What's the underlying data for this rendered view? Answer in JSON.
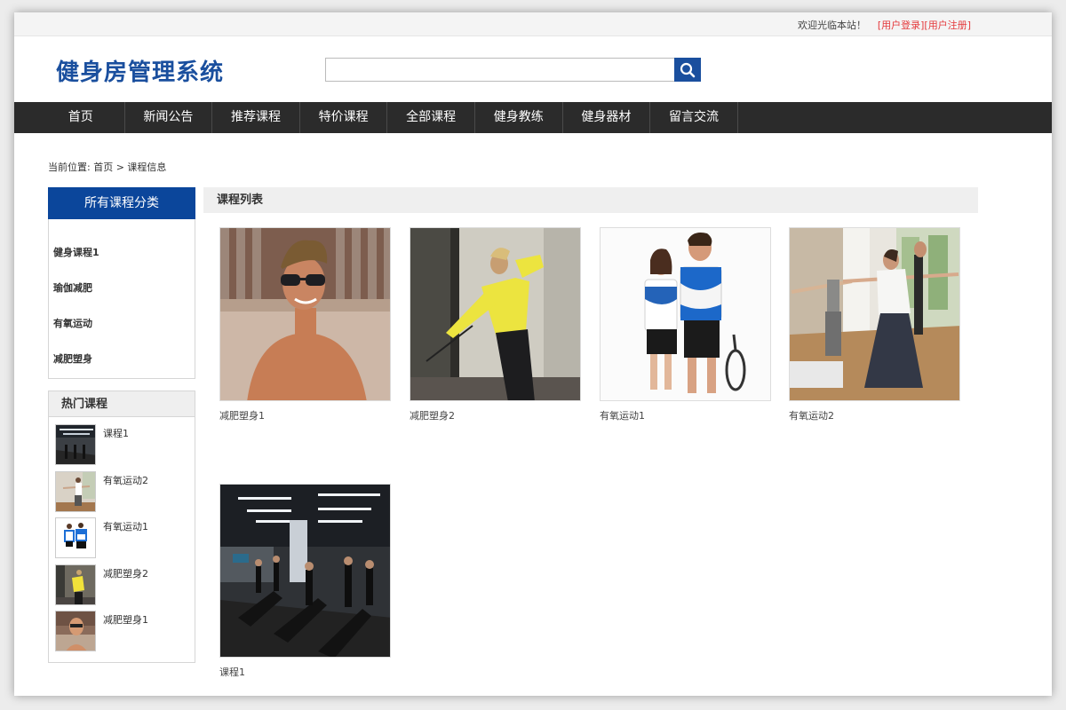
{
  "topbar": {
    "welcome": "欢迎光临本站！",
    "login": "[用户登录]",
    "register": "[用户注册]"
  },
  "header": {
    "logo": "健身房管理系统",
    "search_placeholder": "",
    "search_icon": "search-icon"
  },
  "nav": {
    "items": [
      "首页",
      "新闻公告",
      "推荐课程",
      "特价课程",
      "全部课程",
      "健身教练",
      "健身器材",
      "留言交流"
    ]
  },
  "breadcrumb": "当前位置: 首页 >  课程信息",
  "sidebar": {
    "categories_title": "所有课程分类",
    "categories": [
      "健身课程1",
      "瑜伽减肥",
      "有氧运动",
      "减肥塑身"
    ],
    "hot_title": "热门课程",
    "hot": [
      "课程1",
      "有氧运动2",
      "有氧运动1",
      "减肥塑身2",
      "减肥塑身1"
    ]
  },
  "main": {
    "list_title": "课程列表",
    "courses": [
      "减肥塑身1",
      "减肥塑身2",
      "有氧运动1",
      "有氧运动2",
      "课程1"
    ]
  },
  "colors": {
    "brand": "#1a4f9e",
    "nav_bg": "#2b2b2b",
    "accent": "#e4393c"
  }
}
